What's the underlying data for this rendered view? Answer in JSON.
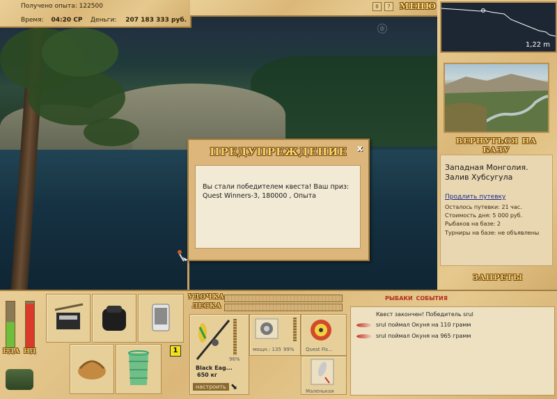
{
  "stats": {
    "xp_label": "Получено опыта:",
    "xp_value": "122500",
    "time_label": "Время:",
    "time_value": "04:20 СР",
    "money_label": "Деньги:",
    "money_value": "207 183 333 руб."
  },
  "top_controls": {
    "pause": "II",
    "help": "?",
    "menu": "МЕНЮ"
  },
  "depth": {
    "value": "1,22 m"
  },
  "location": {
    "return_label": "ВЕРНУТЬСЯ НА БАЗУ",
    "name": "Западная Монголия. Залив Хубсугула",
    "extend_link": "Продлить путевку",
    "trip_left": "Осталось путевки: 21 час.",
    "day_cost": "Стоимость дня: 5 000 руб.",
    "anglers": "Рыбаков на базе: 2",
    "tournaments": "Турниры на базе: не объявлены",
    "bans_label": "ЗАПРЕТЫ"
  },
  "dialog": {
    "title": "ПРЕДУПРЕЖДЕНИЕ",
    "close": "x",
    "message": "Вы стали победителем квеста! Ваш приз: Quest Winners-3, 180000 , Опыта"
  },
  "meters": {
    "food_label": "ЕДА",
    "food_level": 0.55,
    "fish_label": "НД",
    "fish_level": 0.95
  },
  "inventory": {
    "keepnet_count": "1"
  },
  "tackle": {
    "rod_label": "УДОЧКА",
    "line_label": "ЛЕСКА",
    "rod_name": "Black Eag...",
    "rod_weight": "650 кг",
    "rod_condition": "96%",
    "reel_power": "мощн.: 135",
    "reel_condition": "99%",
    "line_name": "Quest Fis...",
    "lure_name": "Маленькая",
    "setup_button": "настроить"
  },
  "events": {
    "tab_fish": "РЫБАКИ",
    "tab_events": "СОБЫТИЯ",
    "items": [
      "Квест закончен! Победитель srul",
      "srul поймал Окуня на 110 грамм",
      "srul поймал Окуня на 965 грамм"
    ]
  },
  "colors": {
    "accent_gold": "#f7d66a",
    "panel_wood": "#dbb879",
    "events_red": "#b32a1e"
  }
}
